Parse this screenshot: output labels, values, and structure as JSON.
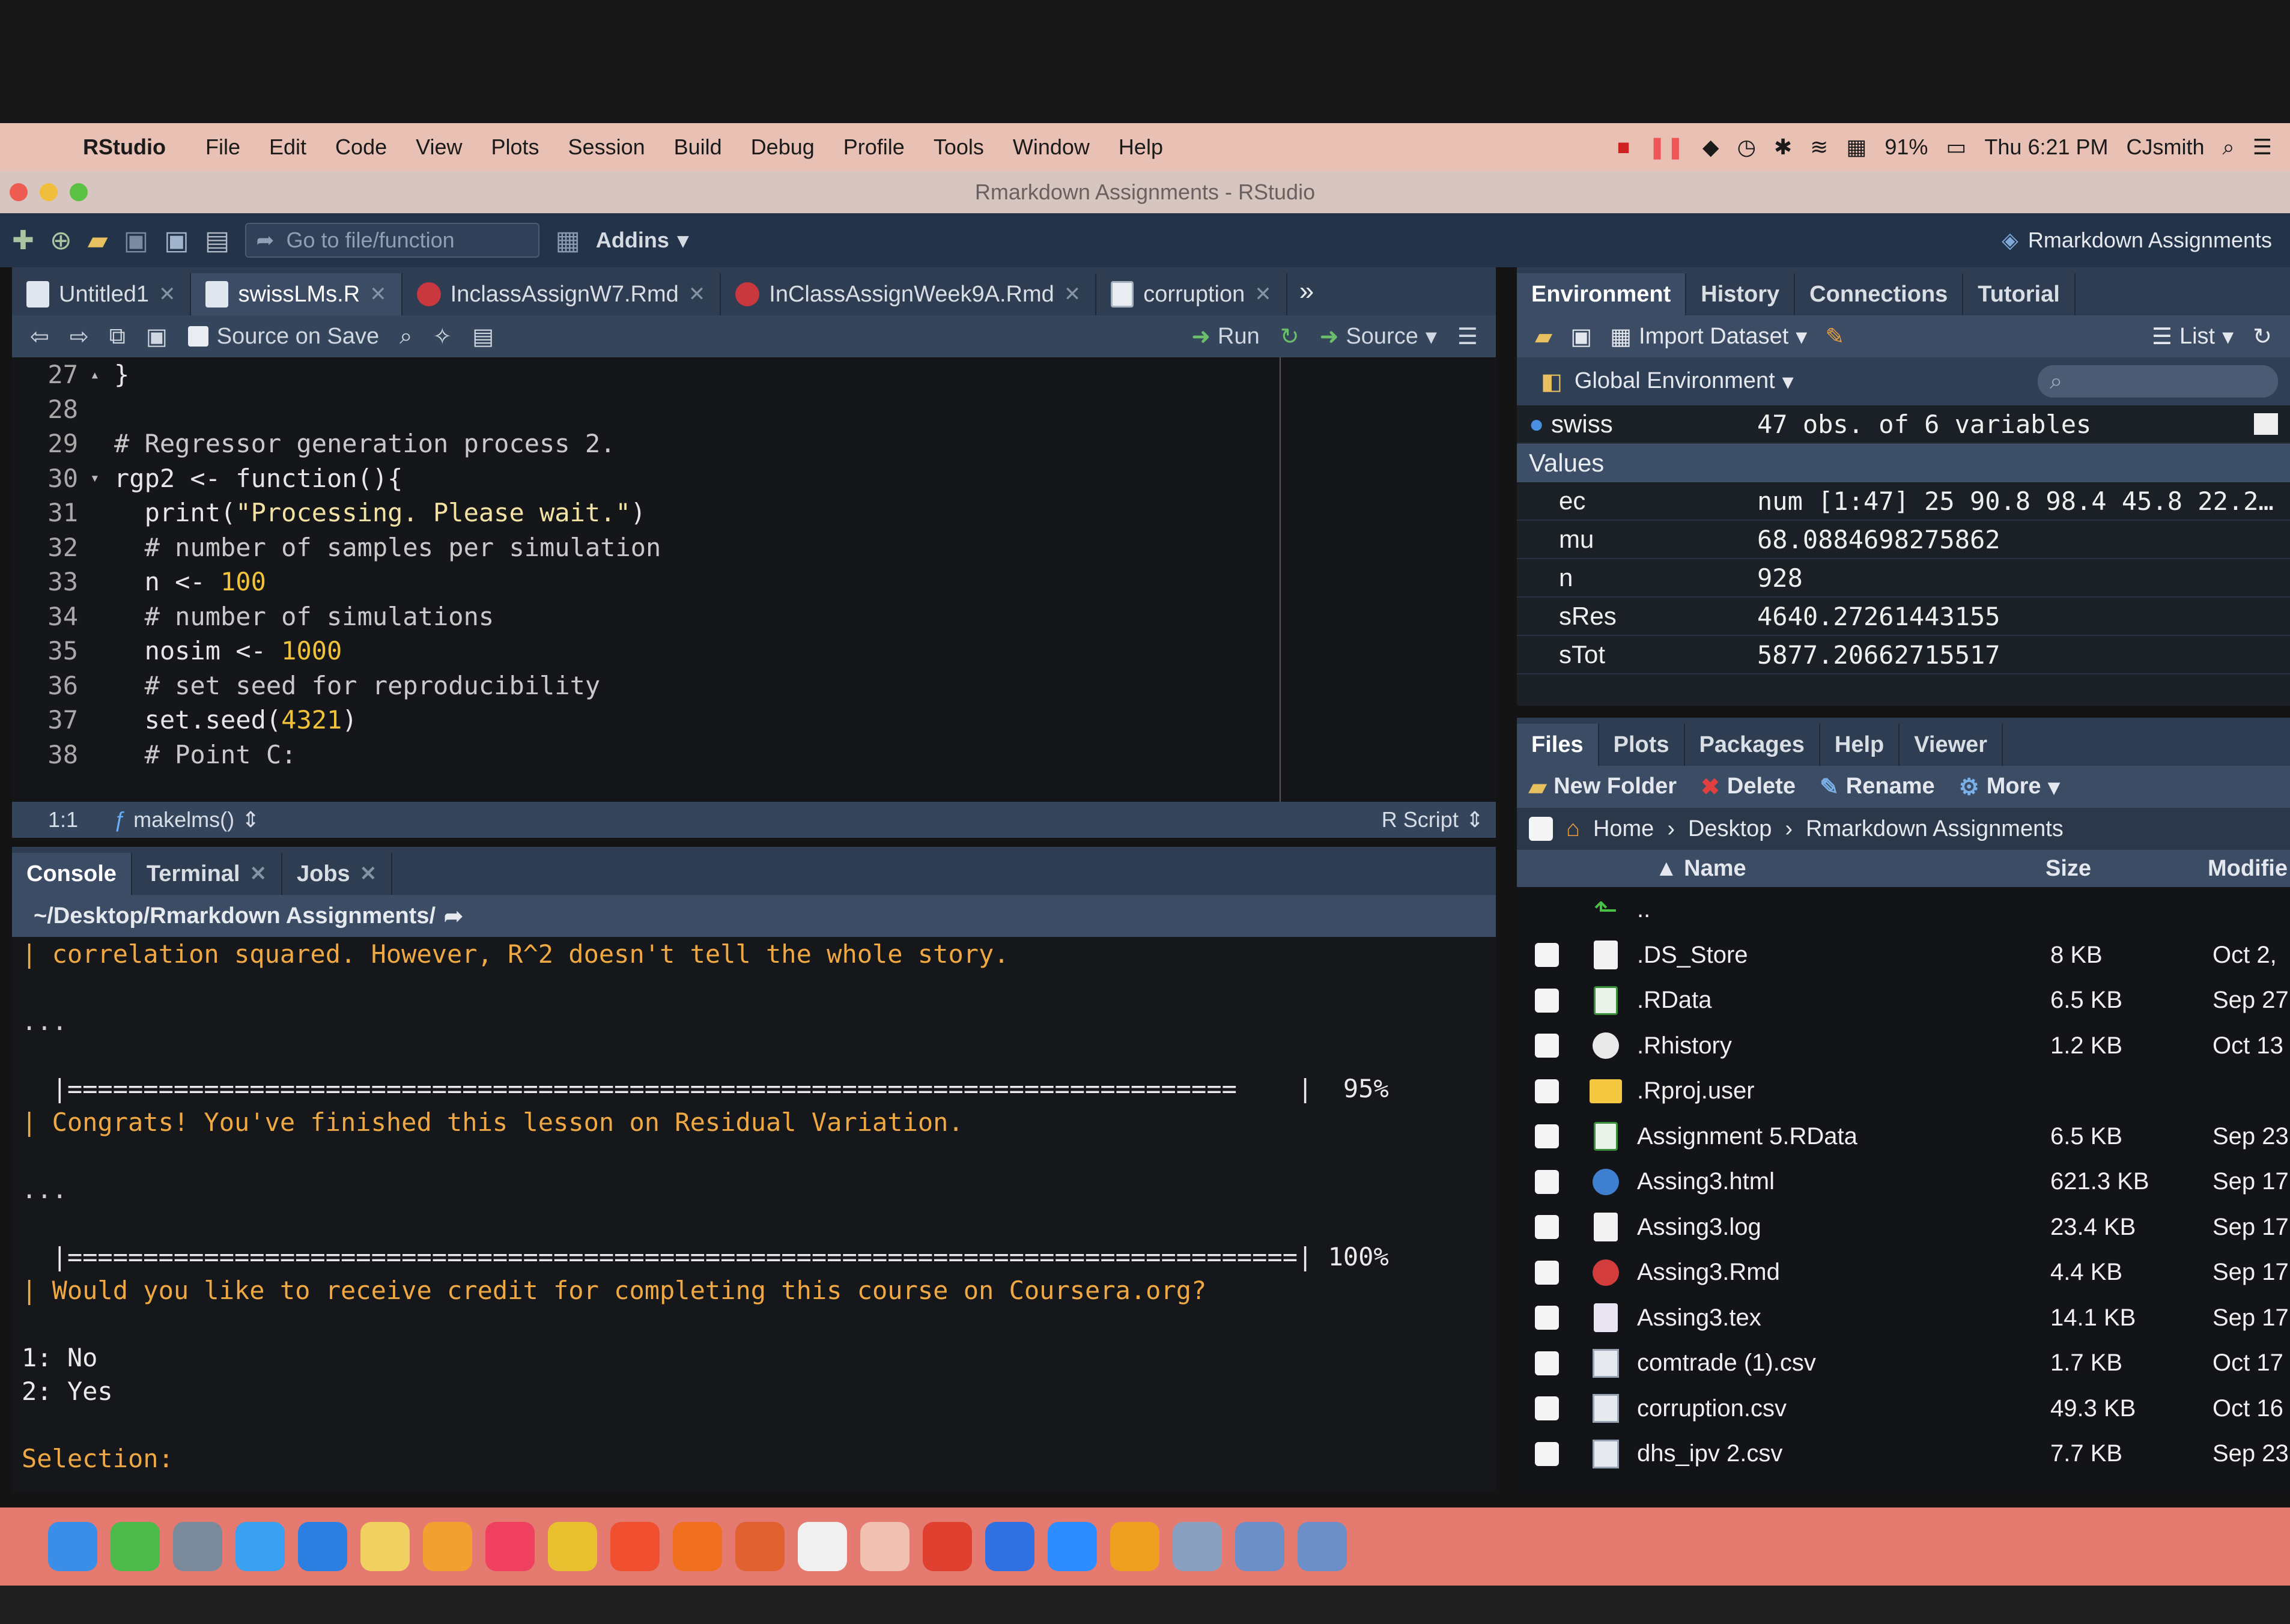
{
  "menubar": {
    "app_name": "RStudio",
    "items": [
      "File",
      "Edit",
      "Code",
      "View",
      "Plots",
      "Session",
      "Build",
      "Debug",
      "Profile",
      "Tools",
      "Window",
      "Help"
    ],
    "battery": "91%",
    "clock": "Thu 6:21 PM",
    "user": "CJsmith"
  },
  "window": {
    "title": "Rmarkdown Assignments - RStudio"
  },
  "toolbar": {
    "goto_placeholder": "Go to file/function",
    "addins": "Addins",
    "project": "Rmarkdown Assignments"
  },
  "source": {
    "tabs": [
      {
        "label": "Untitled1",
        "icon": "r-file-icon"
      },
      {
        "label": "swissLMs.R",
        "icon": "r-file-icon"
      },
      {
        "label": "InclassAssignW7.Rmd",
        "icon": "rmd-file-icon"
      },
      {
        "label": "InClassAssignWeek9A.Rmd",
        "icon": "rmd-file-icon"
      },
      {
        "label": "corruption",
        "icon": "data-grid-icon"
      }
    ],
    "editor_toolbar": {
      "source_on_save": "Source on Save",
      "run": "Run",
      "source": "Source"
    },
    "lines": [
      {
        "num": "27",
        "fold": "▴",
        "html": "}"
      },
      {
        "num": "28",
        "fold": "",
        "html": ""
      },
      {
        "num": "29",
        "fold": "",
        "html": "# Regressor generation process 2."
      },
      {
        "num": "30",
        "fold": "▾",
        "html": "rgp2 <- function(){"
      },
      {
        "num": "31",
        "fold": "",
        "html": "  print(\"Processing. Please wait.\")"
      },
      {
        "num": "32",
        "fold": "",
        "html": "  # number of samples per simulation"
      },
      {
        "num": "33",
        "fold": "",
        "html": "  n <- 100"
      },
      {
        "num": "34",
        "fold": "",
        "html": "  # number of simulations"
      },
      {
        "num": "35",
        "fold": "",
        "html": "  nosim <- 1000"
      },
      {
        "num": "36",
        "fold": "",
        "html": "  # set seed for reproducibility"
      },
      {
        "num": "37",
        "fold": "",
        "html": "  set.seed(4321)"
      },
      {
        "num": "38",
        "fold": "",
        "html": "  # Point C:"
      }
    ],
    "status": {
      "position": "1:1",
      "function": "makelms()",
      "file_type": "R Script"
    }
  },
  "console": {
    "tabs": [
      "Console",
      "Terminal",
      "Jobs"
    ],
    "path": "~/Desktop/Rmarkdown Assignments/",
    "lines": [
      {
        "cls": "orange",
        "text": "| correlation squared. However, R^2 doesn't tell the whole story."
      },
      {
        "cls": "white",
        "text": ""
      },
      {
        "cls": "gray",
        "text": "..."
      },
      {
        "cls": "white",
        "text": ""
      },
      {
        "cls": "progress",
        "text": "  |=============================================================================    |  95%"
      },
      {
        "cls": "orange",
        "text": "| Congrats! You've finished this lesson on Residual Variation."
      },
      {
        "cls": "white",
        "text": ""
      },
      {
        "cls": "gray",
        "text": "..."
      },
      {
        "cls": "white",
        "text": ""
      },
      {
        "cls": "progress",
        "text": "  |=================================================================================| 100%"
      },
      {
        "cls": "orange",
        "text": "| Would you like to receive credit for completing this course on Coursera.org?"
      },
      {
        "cls": "white",
        "text": ""
      },
      {
        "cls": "white",
        "text": "1: No"
      },
      {
        "cls": "white",
        "text": "2: Yes"
      },
      {
        "cls": "white",
        "text": ""
      },
      {
        "cls": "orange",
        "text": "Selection: "
      }
    ]
  },
  "environment": {
    "tabs": [
      "Environment",
      "History",
      "Connections",
      "Tutorial"
    ],
    "import_dataset": "Import Dataset",
    "list_mode": "List",
    "scope": "Global Environment",
    "data_rows": [
      {
        "name": "swiss",
        "value": "47 obs. of 6 variables"
      }
    ],
    "values_header": "Values",
    "values": [
      {
        "name": "ec",
        "value": "num [1:47] 25 90.8 98.4 45.8 22.2…"
      },
      {
        "name": "mu",
        "value": "68.0884698275862"
      },
      {
        "name": "n",
        "value": "928"
      },
      {
        "name": "sRes",
        "value": "4640.27261443155"
      },
      {
        "name": "sTot",
        "value": "5877.20662715517"
      }
    ]
  },
  "files": {
    "tabs": [
      "Files",
      "Plots",
      "Packages",
      "Help",
      "Viewer"
    ],
    "toolbar": {
      "new_folder": "New Folder",
      "delete": "Delete",
      "rename": "Rename",
      "more": "More"
    },
    "breadcrumb": [
      "Home",
      "Desktop",
      "Rmarkdown Assignments"
    ],
    "columns": {
      "name": "Name",
      "size": "Size",
      "modified": "Modifie"
    },
    "up_label": "..",
    "rows": [
      {
        "name": ".DS_Store",
        "size": "8 KB",
        "modified": "Oct 2,",
        "icon": "doc"
      },
      {
        "name": ".RData",
        "size": "6.5 KB",
        "modified": "Sep 27",
        "icon": "rdata"
      },
      {
        "name": ".Rhistory",
        "size": "1.2 KB",
        "modified": "Oct 13",
        "icon": "hist"
      },
      {
        "name": ".Rproj.user",
        "size": "",
        "modified": "",
        "icon": "folder"
      },
      {
        "name": "Assignment 5.RData",
        "size": "6.5 KB",
        "modified": "Sep 23",
        "icon": "rdata"
      },
      {
        "name": "Assing3.html",
        "size": "621.3 KB",
        "modified": "Sep 17",
        "icon": "html"
      },
      {
        "name": "Assing3.log",
        "size": "23.4 KB",
        "modified": "Sep 17",
        "icon": "doc"
      },
      {
        "name": "Assing3.Rmd",
        "size": "4.4 KB",
        "modified": "Sep 17",
        "icon": "rmd"
      },
      {
        "name": "Assing3.tex",
        "size": "14.1 KB",
        "modified": "Sep 17",
        "icon": "tex"
      },
      {
        "name": "comtrade (1).csv",
        "size": "1.7 KB",
        "modified": "Oct 17",
        "icon": "csv"
      },
      {
        "name": "corruption.csv",
        "size": "49.3 KB",
        "modified": "Oct 16",
        "icon": "csv"
      },
      {
        "name": "dhs_ipv 2.csv",
        "size": "7.7 KB",
        "modified": "Sep 23",
        "icon": "csv"
      }
    ]
  },
  "dock": {
    "icons": [
      "finder-icon",
      "facetime-icon",
      "launchpad-icon",
      "messages-icon",
      "safari-icon",
      "notes-icon",
      "photos-icon",
      "music-icon",
      "chrome-icon",
      "brave-icon",
      "firefox-icon",
      "firefox-dev-icon",
      "textedit-icon",
      "help-icon",
      "powerpoint-icon",
      "windows-icon",
      "zoom-icon",
      "books-icon",
      "r-icon",
      "rstudio-icon",
      "rstudio-icon-2"
    ],
    "colors": [
      "#3b8ee8",
      "#4cbb4c",
      "#7b8a9a",
      "#3aa0f0",
      "#2b7fe0",
      "#f0d060",
      "#f2a030",
      "#f04060",
      "#e8c030",
      "#f05030",
      "#f07020",
      "#e06030",
      "#f0f0f0",
      "#f0c0b0",
      "#e04030",
      "#3070e0",
      "#2d8cff",
      "#f0a020",
      "#8aa0c0",
      "#6d8fc8",
      "#6d8fc8"
    ]
  }
}
